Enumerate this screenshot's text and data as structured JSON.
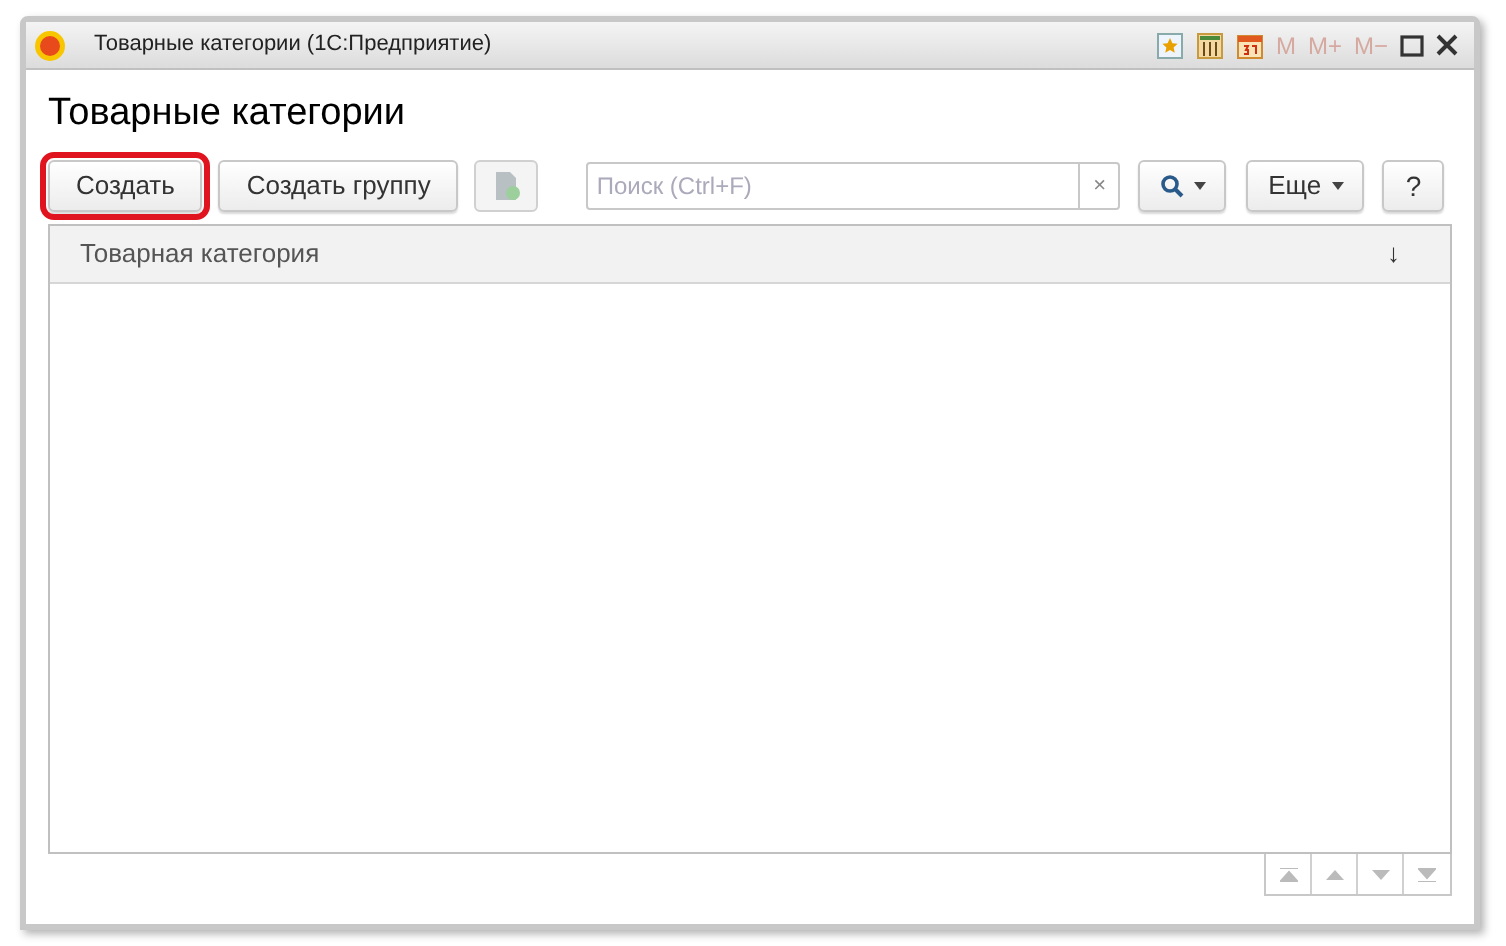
{
  "window": {
    "title": "Товарные категории (1С:Предприятие)",
    "memory_buttons": [
      "M",
      "M+",
      "M−"
    ]
  },
  "heading": "Товарные категории",
  "toolbar": {
    "buttons": [
      {
        "label": "Создать",
        "highlighted": true
      },
      {
        "label": "Создать группу",
        "highlighted": false
      }
    ],
    "search": {
      "placeholder": "Поиск (Ctrl+F)",
      "clear": "×"
    },
    "more": "Еще",
    "help": "?"
  },
  "table": {
    "columns": [
      {
        "label": "Товарная категория",
        "sort": "↓"
      }
    ]
  }
}
